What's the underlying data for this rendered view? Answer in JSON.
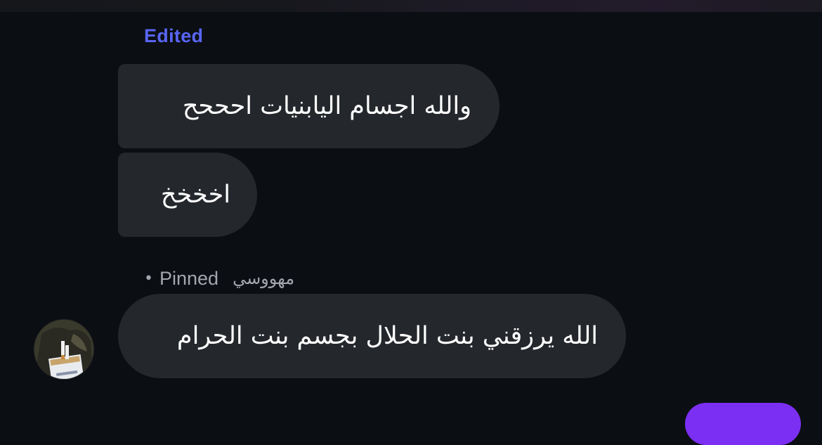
{
  "header": {
    "edited_label": "Edited"
  },
  "messages": [
    {
      "text": "والله اجسام اليابنيات احححح"
    },
    {
      "text": "اخخخخ"
    }
  ],
  "pinned_message": {
    "dot": "•",
    "pinned_label": "Pinned",
    "author": "مهووسي",
    "text": "الله يرزقني بنت الحلال بجسم بنت الحرام"
  },
  "colors": {
    "accent": "#5865f2",
    "bubble": "#24272c",
    "background": "#0b0e13",
    "send_button": "#7b2ff2"
  },
  "icons": {
    "avatar": "avatar-image"
  }
}
